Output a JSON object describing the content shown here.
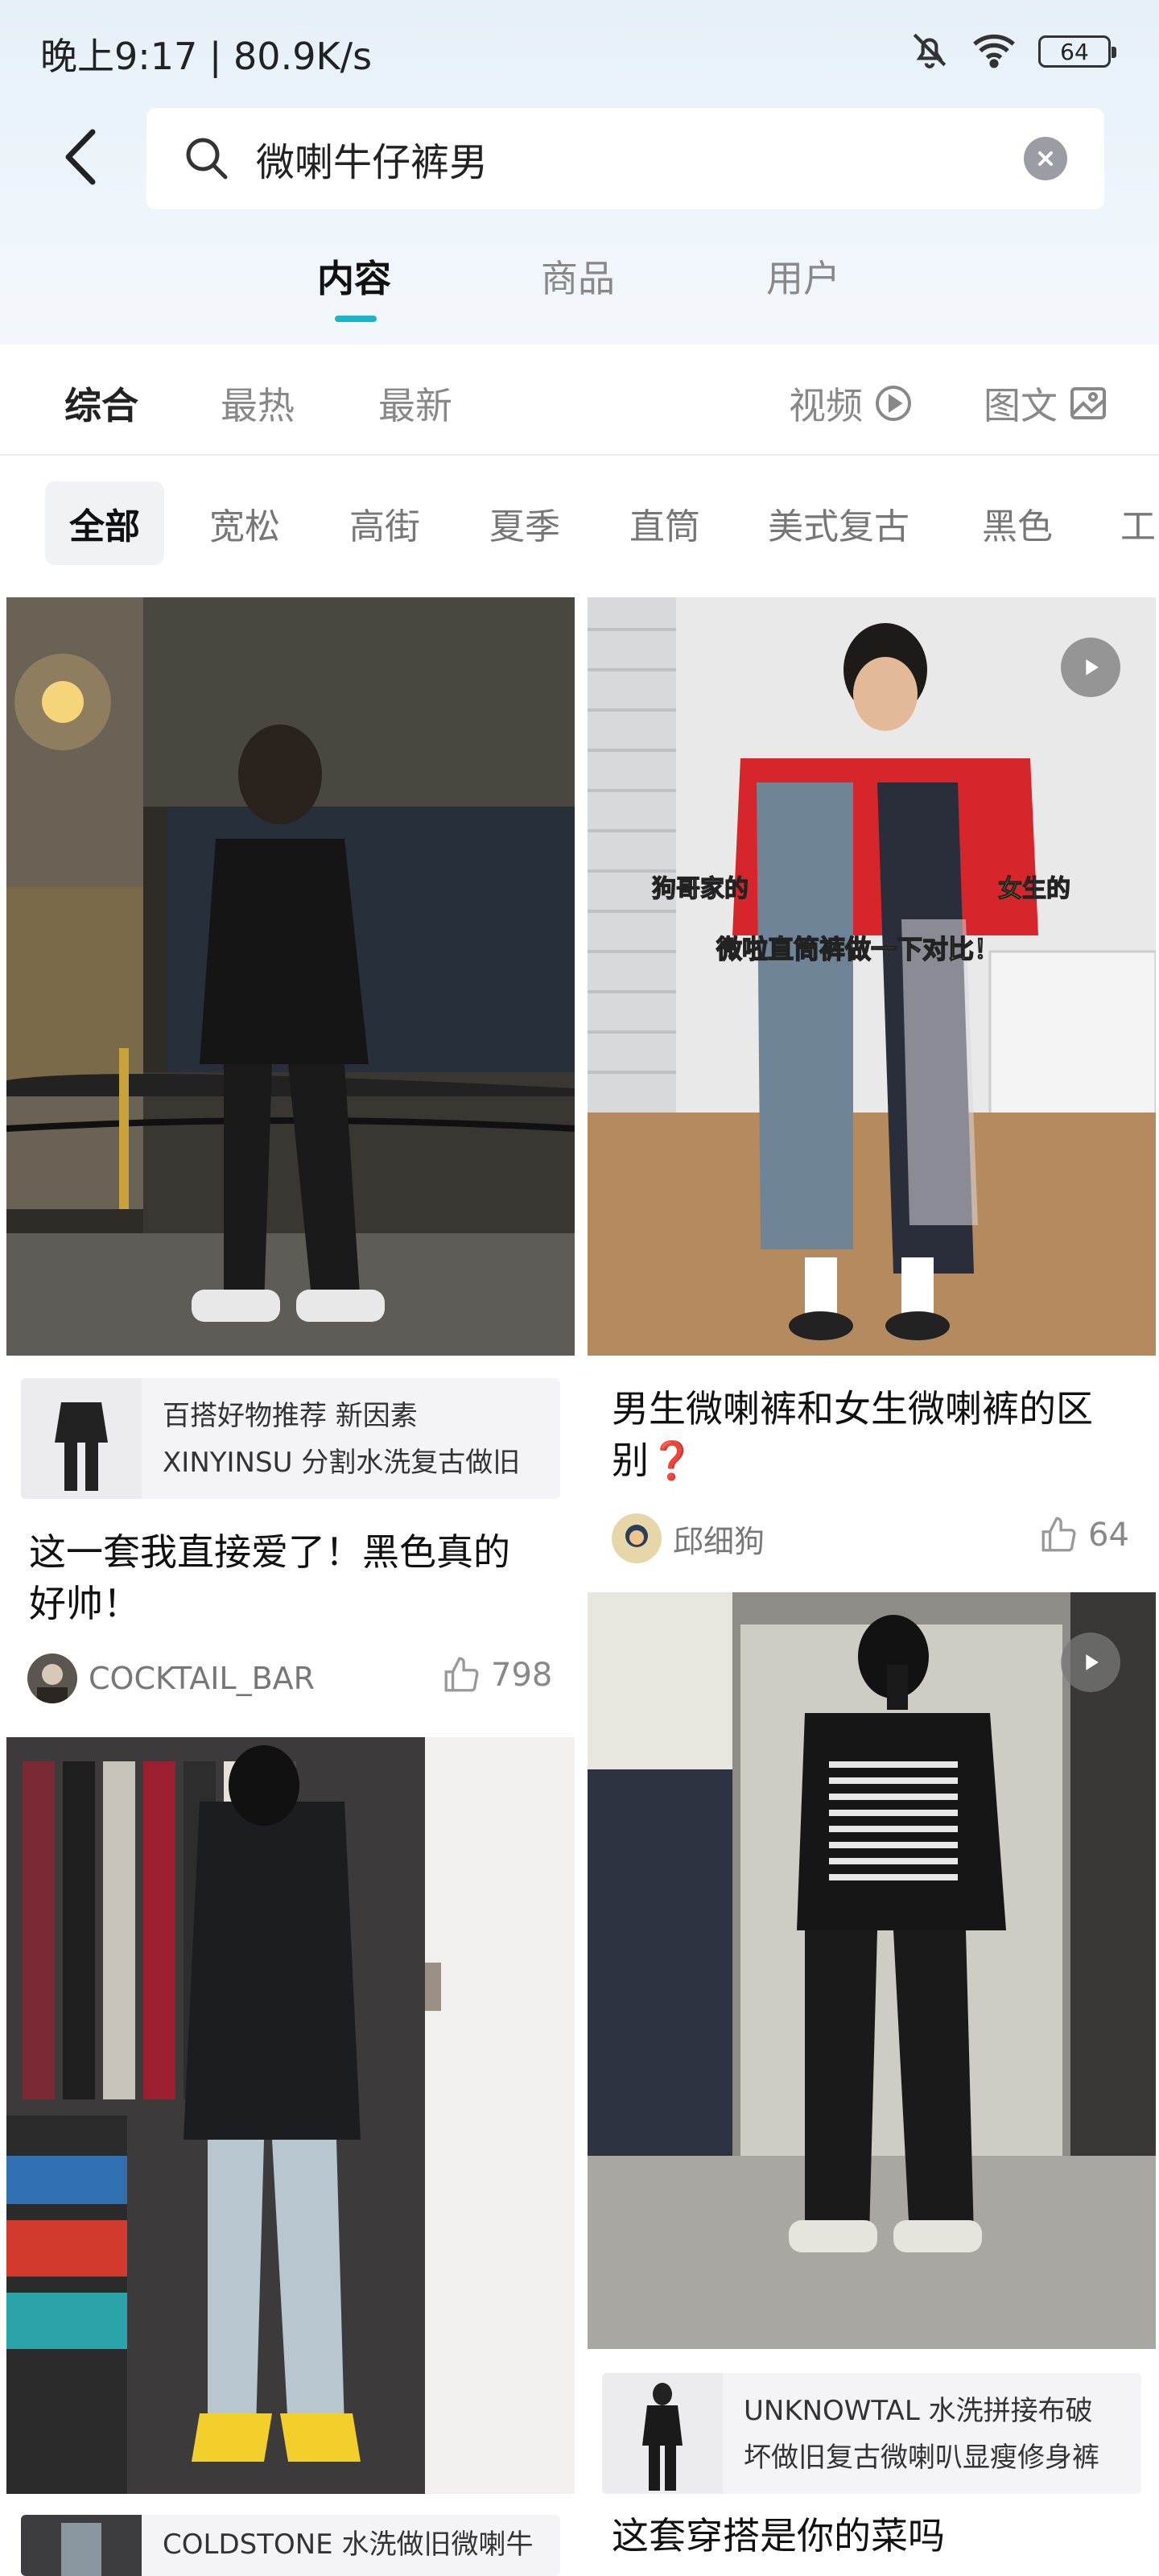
{
  "status_bar": {
    "time_speed": "晚上9:17 | 80.9K/s",
    "battery": "64",
    "icons": [
      "bell-muted-icon",
      "wifi-icon",
      "battery-icon"
    ]
  },
  "search": {
    "query": "微喇牛仔裤男",
    "back_icon": "back-arrow-icon",
    "search_icon": "search-icon",
    "clear_icon": "clear-icon"
  },
  "main_tabs": [
    {
      "label": "内容",
      "active": true
    },
    {
      "label": "商品",
      "active": false
    },
    {
      "label": "用户",
      "active": false
    }
  ],
  "sort": {
    "items": [
      {
        "label": "综合",
        "active": true
      },
      {
        "label": "最热",
        "active": false
      },
      {
        "label": "最新",
        "active": false
      }
    ],
    "video_label": "视频",
    "image_text_label": "图文"
  },
  "filters": [
    {
      "label": "全部",
      "active": true
    },
    {
      "label": "宽松"
    },
    {
      "label": "高街"
    },
    {
      "label": "夏季"
    },
    {
      "label": "直筒"
    },
    {
      "label": "美式复古"
    },
    {
      "label": "黑色"
    },
    {
      "label": "工"
    }
  ],
  "colors": {
    "accent": "#1cb5c5",
    "text_primary": "#111111",
    "text_secondary": "#888888"
  },
  "feed": {
    "card1": {
      "product_line1": "百搭好物推荐 新因素",
      "product_line2": "XINYINSU 分割水洗复古做旧",
      "title_line1": "这一套我直接爱了！黑色真的",
      "title_line2": "好帅！",
      "author": "COCKTAIL_BAR",
      "likes": "798"
    },
    "card2": {
      "overlay_left": "狗哥家的",
      "overlay_right": "女生的",
      "overlay_center": "微啦直筒裤做一下对比！",
      "title_line1": "男生微喇裤和女生微喇裤的区",
      "title_line2": "别❓",
      "author": "邱细狗",
      "likes": "64"
    },
    "card3": {
      "product_line1": "COLDSTONE 水洗做旧微喇牛"
    },
    "card4": {
      "product_line1": "UNKNOWTAL 水洗拼接布破",
      "product_line2": "坏做旧复古微喇叭显瘦修身裤",
      "title_line1": "这套穿搭是你的菜吗"
    }
  }
}
